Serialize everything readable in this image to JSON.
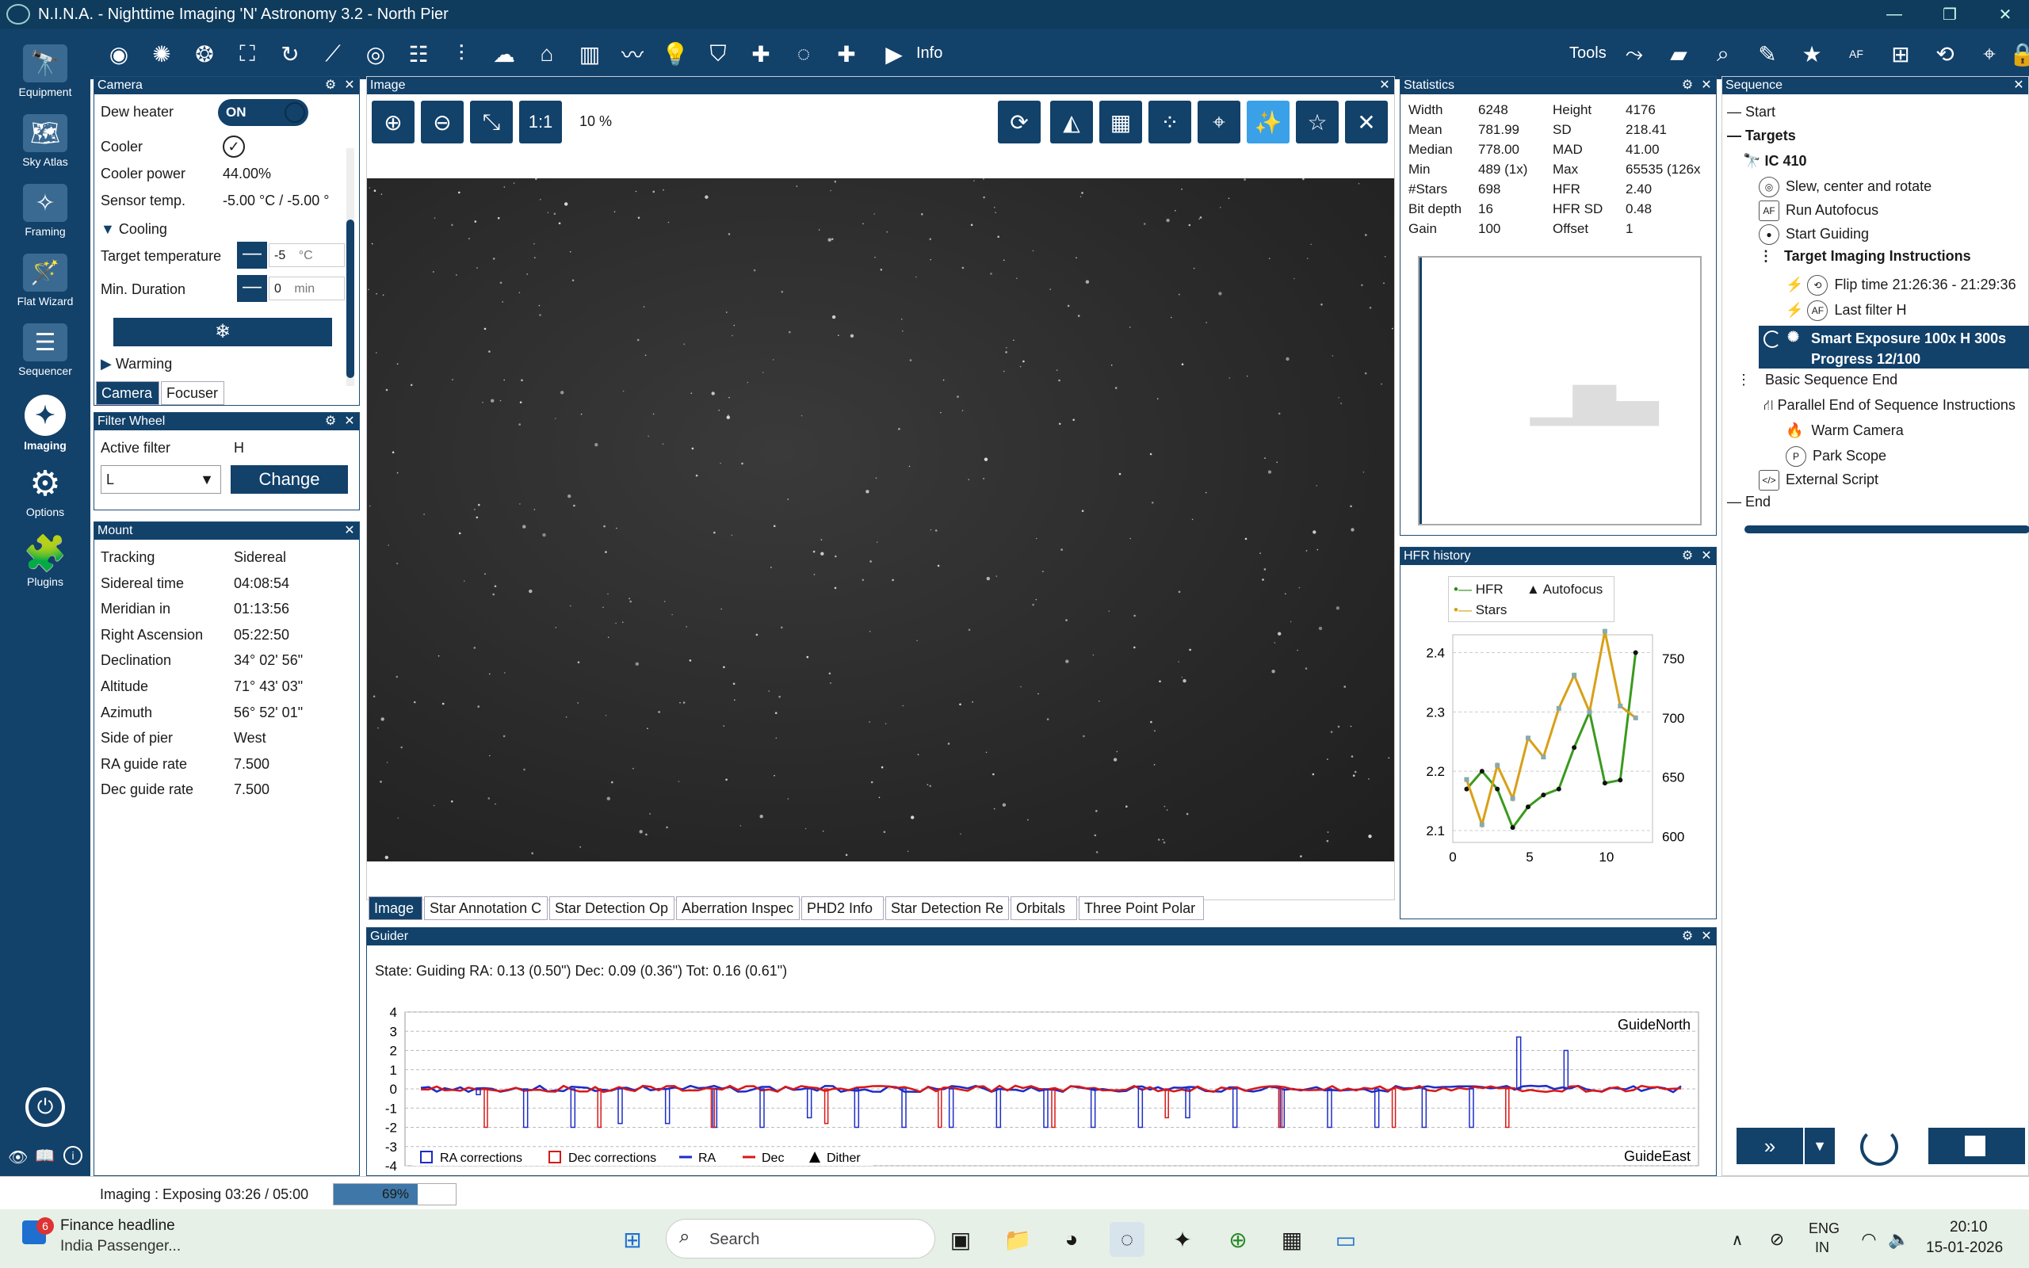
{
  "window": {
    "title": "N.I.N.A. - Nighttime Imaging 'N' Astronomy 3.2  -  North Pier",
    "min": "—",
    "max": "❐",
    "close": "✕"
  },
  "sidebar": {
    "items": [
      {
        "label": "Equipment",
        "icon": "telescope-icon"
      },
      {
        "label": "Sky Atlas",
        "icon": "atlas-icon"
      },
      {
        "label": "Framing",
        "icon": "framing-icon"
      },
      {
        "label": "Flat Wizard",
        "icon": "flat-wizard-icon"
      },
      {
        "label": "Sequencer",
        "icon": "sequencer-icon"
      },
      {
        "label": "Imaging",
        "icon": "imaging-icon"
      },
      {
        "label": "Options",
        "icon": "gear-icon"
      },
      {
        "label": "Plugins",
        "icon": "puzzle-icon"
      }
    ],
    "collapse": "<<"
  },
  "toolbar": {
    "info_label": "Info",
    "tools_label": "Tools"
  },
  "camera": {
    "title": "Camera",
    "dew_heater_label": "Dew heater",
    "dew_heater_value": "ON",
    "cooler_label": "Cooler",
    "cooler_power_label": "Cooler power",
    "cooler_power_value": "44.00%",
    "sensor_temp_label": "Sensor temp.",
    "sensor_temp_value": "-5.00 °C / -5.00 °",
    "cooling_label": "Cooling",
    "target_temp_label": "Target temperature",
    "target_temp_value": "-5",
    "target_temp_unit": "°C",
    "min_duration_label": "Min. Duration",
    "min_duration_value": "0",
    "min_duration_unit": "min",
    "warming_label": "Warming",
    "tab_camera": "Camera",
    "tab_focuser": "Focuser"
  },
  "filter_wheel": {
    "title": "Filter Wheel",
    "active_filter_label": "Active filter",
    "active_filter_value": "H",
    "selected": "L",
    "change_button": "Change"
  },
  "mount": {
    "title": "Mount",
    "rows": [
      {
        "label": "Tracking",
        "value": "Sidereal"
      },
      {
        "label": "Sidereal time",
        "value": "04:08:54"
      },
      {
        "label": "Meridian in",
        "value": "01:13:56"
      },
      {
        "label": "Right Ascension",
        "value": "05:22:50"
      },
      {
        "label": "Declination",
        "value": "34° 02' 56\""
      },
      {
        "label": "Altitude",
        "value": "71° 43' 03\""
      },
      {
        "label": "Azimuth",
        "value": "56° 52' 01\""
      },
      {
        "label": "Side of pier",
        "value": "West"
      },
      {
        "label": "RA guide rate",
        "value": "7.500"
      },
      {
        "label": "Dec guide rate",
        "value": "7.500"
      }
    ]
  },
  "image": {
    "title": "Image",
    "zoom_label": "1:1",
    "zoom_percent": "10 %",
    "tabs": [
      "Image",
      "Star Annotation C",
      "Star Detection Op",
      "Aberration Inspec",
      "PHD2 Info",
      "Star Detection Re",
      "Orbitals",
      "Three Point Polar"
    ]
  },
  "statistics": {
    "title": "Statistics",
    "rows": [
      {
        "l1": "Width",
        "v1": "6248",
        "l2": "Height",
        "v2": "4176"
      },
      {
        "l1": "Mean",
        "v1": "781.99",
        "l2": "SD",
        "v2": "218.41"
      },
      {
        "l1": "Median",
        "v1": "778.00",
        "l2": "MAD",
        "v2": "41.00"
      },
      {
        "l1": "Min",
        "v1": "489 (1x)",
        "l2": "Max",
        "v2": "65535 (126x"
      },
      {
        "l1": "#Stars",
        "v1": "698",
        "l2": "HFR",
        "v2": "2.40"
      },
      {
        "l1": "Bit depth",
        "v1": "16",
        "l2": "HFR SD",
        "v2": "0.48"
      },
      {
        "l1": "Gain",
        "v1": "100",
        "l2": "Offset",
        "v2": "1"
      }
    ]
  },
  "hfr": {
    "title": "HFR history",
    "legend_hfr": "HFR",
    "legend_stars": "Stars",
    "legend_af": "Autofocus"
  },
  "chart_data": [
    {
      "type": "line",
      "title": "",
      "x": [
        0,
        1,
        2,
        3,
        4,
        5,
        6,
        7,
        8,
        9,
        10,
        11,
        12
      ],
      "series": [
        {
          "name": "HFR",
          "axis": "left",
          "values": [
            2.17,
            2.2,
            2.17,
            2.105,
            2.14,
            2.16,
            2.17,
            2.24,
            2.3,
            2.18,
            2.185,
            2.4,
            null
          ]
        },
        {
          "name": "Stars",
          "axis": "right",
          "values": [
            648,
            610,
            660,
            632,
            683,
            667,
            708,
            736,
            705,
            773,
            710,
            700,
            null
          ]
        }
      ],
      "xticks": [
        0,
        5,
        10
      ],
      "yticks_left": [
        2.1,
        2.2,
        2.3,
        2.4
      ],
      "yticks_right": [
        600,
        650,
        700,
        750
      ],
      "ylim_left": [
        2.08,
        2.43
      ],
      "ylim_right": [
        595,
        770
      ],
      "xlim": [
        0,
        13
      ]
    },
    {
      "type": "bar",
      "title": "",
      "series": [
        {
          "name": "RA corrections",
          "color": "#1c2cc8"
        },
        {
          "name": "Dec corrections",
          "color": "#d81818"
        },
        {
          "name": "RA",
          "color": "#1c2cc8"
        },
        {
          "name": "Dec",
          "color": "#d81818"
        },
        {
          "name": "Dither"
        }
      ],
      "yticks": [
        4,
        3,
        2,
        1,
        0,
        -1,
        -2,
        -3,
        -4
      ],
      "ylim": [
        -4,
        4
      ],
      "ra_bars": [
        -0.3,
        -2,
        -2,
        -1.8,
        -1.8,
        -2,
        -2,
        -1.5,
        -2,
        -2,
        -2,
        -2,
        -2,
        -2,
        -2,
        -1.5,
        -2,
        -2,
        -2,
        -2,
        -2,
        -2,
        2.7,
        2
      ],
      "dec_bars": [
        -2,
        -2,
        -2,
        -1.8,
        -2,
        -2,
        -1.5,
        -2,
        -2,
        -2
      ],
      "annotations": [
        "GuideNorth",
        "GuideEast"
      ]
    }
  ],
  "guider": {
    "title": "Guider",
    "state": "State: Guiding  RA: 0.13 (0.50\")  Dec: 0.09 (0.36\")  Tot: 0.16 (0.61\")",
    "guide_north": "GuideNorth",
    "guide_east": "GuideEast",
    "legend": [
      "RA corrections",
      "Dec corrections",
      "RA",
      "Dec",
      "Dither"
    ]
  },
  "sequence": {
    "title": "Sequence",
    "start": "Start",
    "targets": "Targets",
    "target_name": "IC 410",
    "items": [
      "Slew, center and rotate",
      "Run Autofocus",
      "Start Guiding"
    ],
    "tii_label": "Target Imaging Instructions",
    "flip_time": "Flip time 21:26:36  -  21:29:36",
    "last_filter": "Last filter  H",
    "smart_exposure": "Smart Exposure 100x  H  300s",
    "progress": "Progress 12/100",
    "basic_end": "Basic Sequence End",
    "parallel_end": "Parallel End of Sequence Instructions",
    "warm_camera": "Warm Camera",
    "park_scope": "Park Scope",
    "external_script": "External Script",
    "end": "End"
  },
  "status": {
    "text": "Imaging :   Exposing 03:26 / 05:00",
    "progress_label": "69%",
    "progress": 0.69
  },
  "taskbar": {
    "news_title": "Finance headline",
    "news_sub": "India Passenger...",
    "news_badge": "6",
    "search_placeholder": "Search",
    "lang1": "ENG",
    "lang2": "IN",
    "time": "20:10",
    "date": "15-01-2026"
  }
}
